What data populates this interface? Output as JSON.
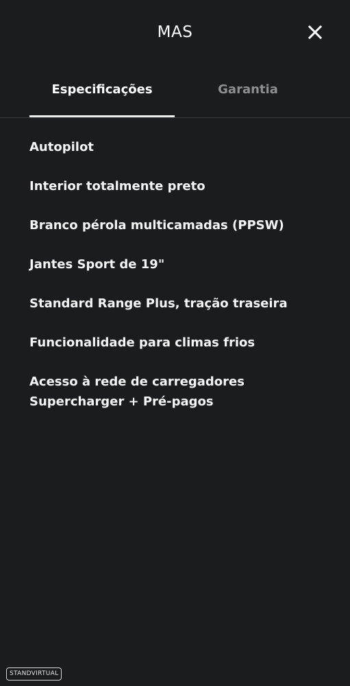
{
  "header": {
    "title": "MAS",
    "close_icon": "close-icon"
  },
  "tabs": [
    {
      "label": "Especificações",
      "active": true
    },
    {
      "label": "Garantia",
      "active": false
    }
  ],
  "specs": [
    "Autopilot",
    "Interior totalmente preto",
    "Branco pérola multicamadas (PPSW)",
    "Jantes Sport de 19\"",
    "Standard Range Plus, tração traseira",
    "Funcionalidade para climas frios",
    "Acesso à rede de carregadores Supercharger + Pré-pagos"
  ],
  "watermark": "STANDVIRTUAL",
  "colors": {
    "background": "#1b1c1e",
    "text": "#ffffff",
    "inactive_tab": "#8e8f92",
    "indicator": "#ececec"
  }
}
